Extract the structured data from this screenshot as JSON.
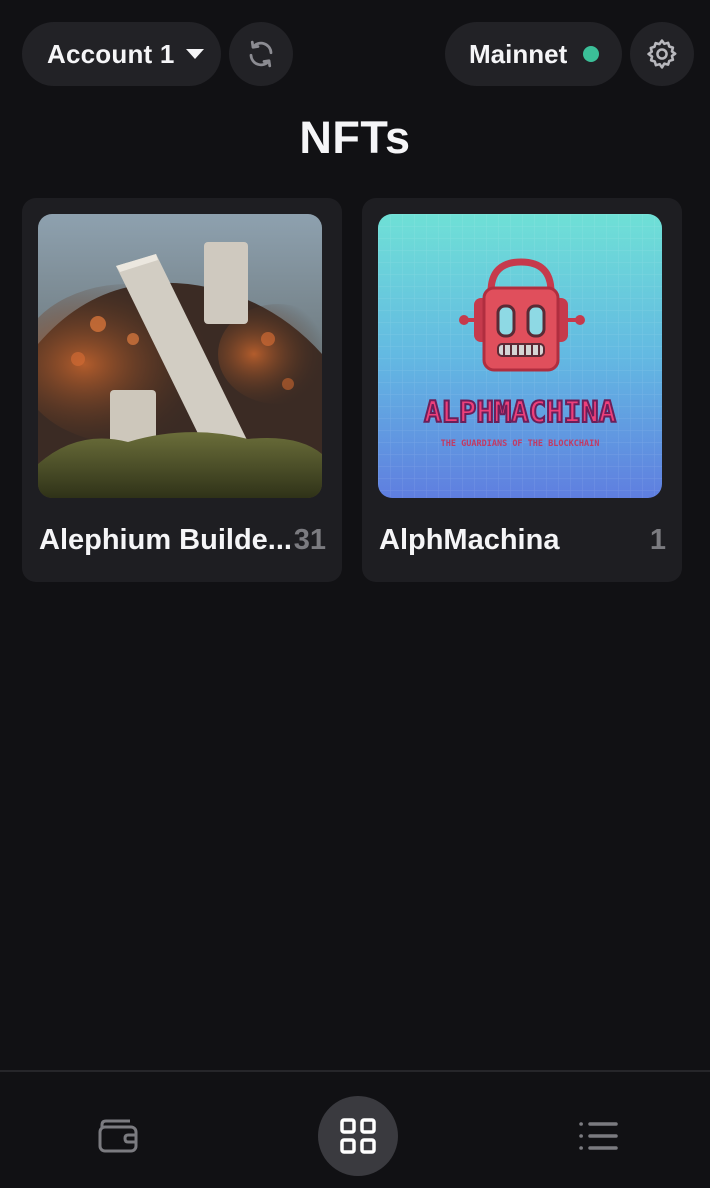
{
  "header": {
    "account_label": "Account 1",
    "network_label": "Mainnet",
    "network_status_color": "#3bbf98",
    "icons": [
      "chevron-down-icon",
      "refresh-icon",
      "gear-icon"
    ]
  },
  "page": {
    "title": "NFTs"
  },
  "collections": [
    {
      "name": "Alephium Builde...",
      "count": "31",
      "thumb": "alephium-logo-art"
    },
    {
      "name": "AlphMachina",
      "count": "1",
      "thumb": "alphmachina-robot-art",
      "art_text": "ALPHMACHINA",
      "art_subtext": "THE GUARDIANS OF THE BLOCKCHAIN"
    }
  ],
  "bottom_nav": {
    "items": [
      "wallet-icon",
      "nfts-grid-icon",
      "activity-list-icon"
    ],
    "active": "nfts-grid-icon"
  },
  "colors": {
    "background": "#111114",
    "surface": "#222226",
    "card": "#1e1e22",
    "accent_green": "#3bbf98"
  }
}
